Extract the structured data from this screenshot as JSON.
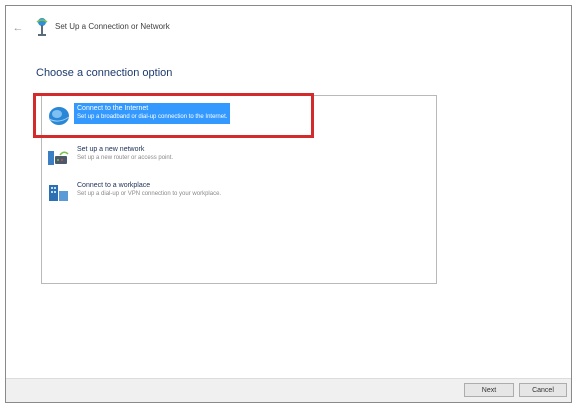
{
  "window": {
    "title": "Set Up a Connection or Network",
    "back_icon": "back-arrow-icon"
  },
  "main": {
    "heading": "Choose a connection option",
    "options": [
      {
        "title": "Connect to the Internet",
        "description": "Set up a broadband or dial-up connection to the Internet.",
        "icon": "globe-icon",
        "selected": true
      },
      {
        "title": "Set up a new network",
        "description": "Set up a new router or access point.",
        "icon": "router-icon",
        "selected": false
      },
      {
        "title": "Connect to a workplace",
        "description": "Set up a dial-up or VPN connection to your workplace.",
        "icon": "workplace-icon",
        "selected": false
      }
    ]
  },
  "footer": {
    "next_label": "Next",
    "cancel_label": "Cancel"
  },
  "colors": {
    "selection": "#3399ff",
    "annotation_border": "#d32b2b",
    "heading": "#1e3a6e"
  }
}
